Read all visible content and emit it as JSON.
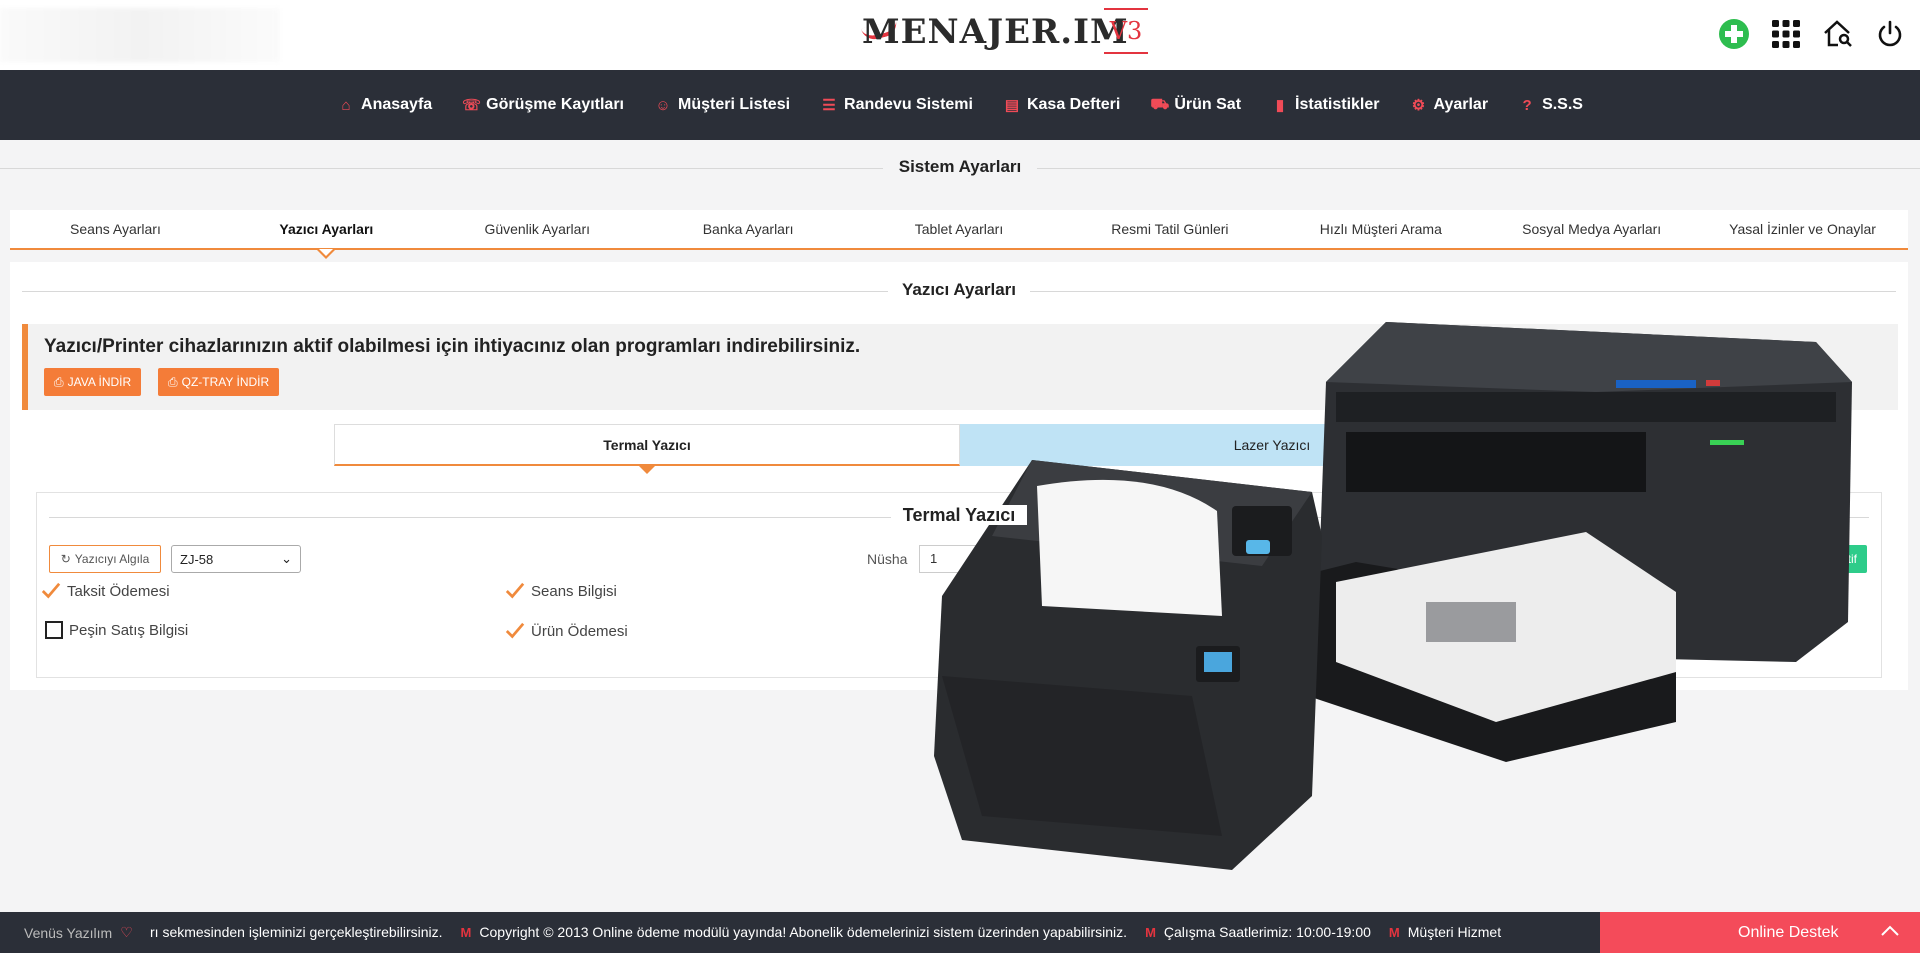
{
  "header": {
    "logo_text": "MENAJER.IM",
    "logo_version": "V3"
  },
  "nav": [
    {
      "label": "Anasayfa",
      "icon": "home-icon"
    },
    {
      "label": "Görüşme Kayıtları",
      "icon": "chat-icon"
    },
    {
      "label": "Müşteri Listesi",
      "icon": "users-icon"
    },
    {
      "label": "Randevu Sistemi",
      "icon": "list-icon"
    },
    {
      "label": "Kasa Defteri",
      "icon": "ledger-icon"
    },
    {
      "label": "Ürün Sat",
      "icon": "cart-icon"
    },
    {
      "label": "İstatistikler",
      "icon": "bar-chart-icon"
    },
    {
      "label": "Ayarlar",
      "icon": "gear-icon"
    },
    {
      "label": "S.S.S",
      "icon": "question-icon"
    }
  ],
  "page": {
    "title": "Sistem Ayarları"
  },
  "settings_tabs": [
    "Seans Ayarları",
    "Yazıcı Ayarları",
    "Güvenlik Ayarları",
    "Banka Ayarları",
    "Tablet Ayarları",
    "Resmi Tatil Günleri",
    "Hızlı Müşteri Arama",
    "Sosyal Medya Ayarları",
    "Yasal İzinler ve Onaylar"
  ],
  "panel": {
    "title": "Yazıcı Ayarları",
    "alert_text": "Yazıcı/Printer cihazlarınızın aktif olabilmesi için ihtiyacınız olan programları indirebilirsiniz.",
    "java_button": "JAVA İNDİR",
    "qz_button": "QZ-TRAY İNDİR",
    "printer_tabs": [
      "Termal Yazıcı",
      "Lazer Yazıcı"
    ],
    "inner_title": "Termal Yazıcı",
    "detect_button": "Yazıcıyı Algıla",
    "selected_printer": "ZJ-58",
    "copies_label": "Nüsha",
    "copies_value": "1",
    "active_button": "ktif",
    "checkboxes": [
      {
        "label": "Taksit Ödemesi",
        "checked": true
      },
      {
        "label": "Seans Bilgisi",
        "checked": true
      },
      {
        "label": "Peşin Satış Bilgisi",
        "checked": false
      },
      {
        "label": "Ürün Ödemesi",
        "checked": true
      }
    ]
  },
  "footer": {
    "brand": "Venüs Yazılım",
    "ticker": [
      "rı sekmesinden işleminizi gerçekleştirebilirsiniz.",
      "Copyright © 2013 Online ödeme modülü yayında! Abonelik ödemelerinizi sistem üzerinden yapabilirsiniz.",
      "Çalışma Saatlerimiz: 10:00-19:00",
      "Müşteri Hizmet"
    ],
    "online_support": "Online Destek"
  },
  "colors": {
    "accent": "#f08a3c",
    "nav_bg": "#2b2f38",
    "brand_red": "#e3343f",
    "support_red": "#f44b5a",
    "active_green": "#2ecc8a"
  }
}
